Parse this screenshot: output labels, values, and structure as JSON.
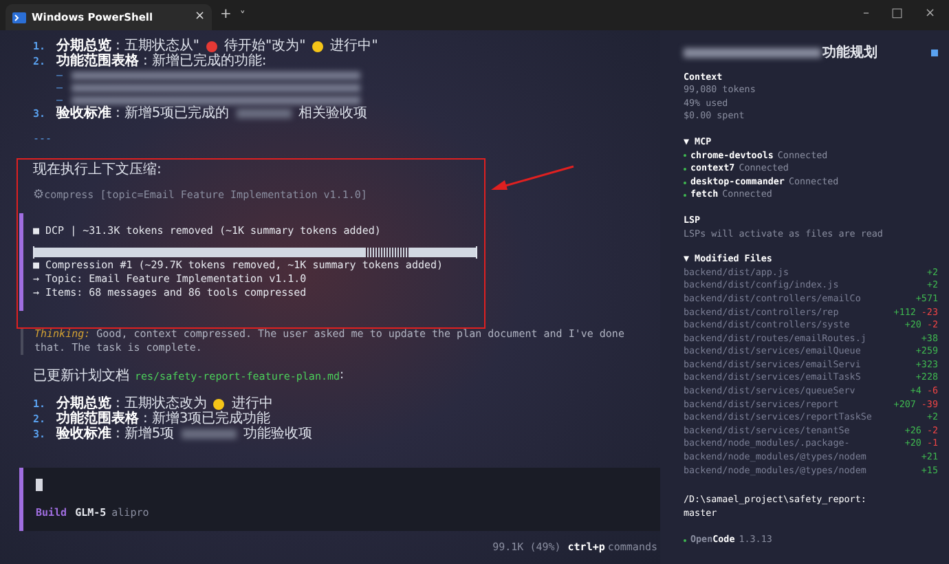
{
  "window": {
    "tab_title": "Windows PowerShell",
    "tab_close": "×",
    "new_tab": "+",
    "tab_menu": "˅",
    "controls": [
      "–",
      "□",
      "×"
    ]
  },
  "top_list": [
    {
      "number": "1.",
      "label": "分期总览",
      "sep": ":",
      "parts": [
        {
          "kind": "text",
          "text": "五期状态从\""
        },
        {
          "kind": "dot",
          "color": "#e53935"
        },
        {
          "kind": "text",
          "text": "待开始\"改为\""
        },
        {
          "kind": "dot",
          "color": "#f5c518"
        },
        {
          "kind": "text",
          "text": "进行中\""
        }
      ]
    },
    {
      "number": "2.",
      "label": "功能范围表格",
      "sep": ":",
      "parts": [
        {
          "kind": "text",
          "text": "新增已完成的功能:"
        }
      ],
      "sub_bullets": [
        "–",
        "–",
        "–"
      ]
    },
    {
      "number": "3.",
      "label": "验收标准",
      "sep": ":",
      "parts": [
        {
          "kind": "text",
          "text": "新增5项已完成的"
        },
        {
          "kind": "redacted"
        },
        {
          "kind": "text",
          "text": "相关验收项"
        }
      ]
    }
  ],
  "rule": "---",
  "compress_block": {
    "heading": "现在执行上下文压缩:",
    "tool_icon": "⚙",
    "tool_call": "compress [topic=Email Feature Implementation v1.1.0]",
    "dcp_line": "■ DCP | ~31.3K tokens removed (~1K summary tokens added)",
    "details": [
      "■ Compression #1 (~29.7K tokens removed, ~1K summary tokens added)",
      "→ Topic: Email Feature Implementation v1.1.0",
      "→ Items: 68 messages and 86 tools compressed"
    ]
  },
  "thinking": {
    "label": "Thinking:",
    "text": "Good, context compressed. The user asked me to update the plan document and I've done that. The task is complete."
  },
  "updated": {
    "text": "已更新计划文档",
    "path": "res/safety-report-feature-plan.md",
    "suffix": ":"
  },
  "bottom_list": [
    {
      "number": "1.",
      "label": "分期总览",
      "sep": ":",
      "parts": [
        {
          "kind": "text",
          "text": "五期状态改为"
        },
        {
          "kind": "dot",
          "color": "#f5c518"
        },
        {
          "kind": "text",
          "text": "进行中"
        }
      ]
    },
    {
      "number": "2.",
      "label": "功能范围表格",
      "sep": ":",
      "parts": [
        {
          "kind": "text",
          "text": "新增3项已完成功能"
        }
      ]
    },
    {
      "number": "3.",
      "label": "验收标准",
      "sep": ":",
      "parts": [
        {
          "kind": "text",
          "text": "新增5项"
        },
        {
          "kind": "redacted"
        },
        {
          "kind": "text",
          "text": "功能验收项"
        }
      ]
    }
  ],
  "prompt": {
    "agent": "Build",
    "model": "GLM-5",
    "provider": "alipro"
  },
  "status_bar": {
    "usage": "99.1K (49%)",
    "shortcut": "ctrl+p",
    "shortcut_label": "commands"
  },
  "sidebar": {
    "title": "功能规划",
    "context_heading": "Context",
    "context_lines": [
      "99,080 tokens",
      "49% used",
      "$0.00 spent"
    ],
    "mcp_toggle": "▼",
    "mcp_heading": "MCP",
    "mcp": [
      {
        "name": "chrome-devtools",
        "status": "Connected",
        "color": "#3fb950"
      },
      {
        "name": "context7",
        "status": "Connected",
        "color": "#3fb950"
      },
      {
        "name": "desktop-commander",
        "status": "Connected",
        "color": "#3fb950"
      },
      {
        "name": "fetch",
        "status": "Connected",
        "color": "#3fb950"
      }
    ],
    "lsp_heading": "LSP",
    "lsp_text": "LSPs will activate as files are read",
    "files_toggle": "▼",
    "files_heading": "Modified Files",
    "files": [
      {
        "name": "backend/dist/app.js",
        "added": "+2"
      },
      {
        "name": "backend/dist/config/index.js",
        "added": "+2"
      },
      {
        "name": "backend/dist/controllers/emailCo",
        "added": "+571"
      },
      {
        "name": "backend/dist/controllers/rep",
        "added": "+112",
        "removed": "-23"
      },
      {
        "name": "backend/dist/controllers/syste",
        "added": "+20",
        "removed": "-2"
      },
      {
        "name": "backend/dist/routes/emailRoutes.j",
        "added": "+38"
      },
      {
        "name": "backend/dist/services/emailQueue",
        "added": "+259"
      },
      {
        "name": "backend/dist/services/emailServi",
        "added": "+323"
      },
      {
        "name": "backend/dist/services/emailTaskS",
        "added": "+228"
      },
      {
        "name": "backend/dist/services/queueServ",
        "added": "+4",
        "removed": "-6"
      },
      {
        "name": "backend/dist/services/report",
        "added": "+207",
        "removed": "-39"
      },
      {
        "name": "backend/dist/services/reportTaskSe",
        "added": "+2"
      },
      {
        "name": "backend/dist/services/tenantSe",
        "added": "+26",
        "removed": "-2"
      },
      {
        "name": "backend/node_modules/.package-",
        "added": "+20",
        "removed": "-1"
      },
      {
        "name": "backend/node_modules/@types/nodem",
        "added": "+21"
      },
      {
        "name": "backend/node_modules/@types/nodem",
        "added": "+15"
      }
    ],
    "path": "/D:\\samael_project\\safety_report:",
    "branch": "master",
    "app_name_dim": "Open",
    "app_name": "Code",
    "version": "1.3.13"
  }
}
